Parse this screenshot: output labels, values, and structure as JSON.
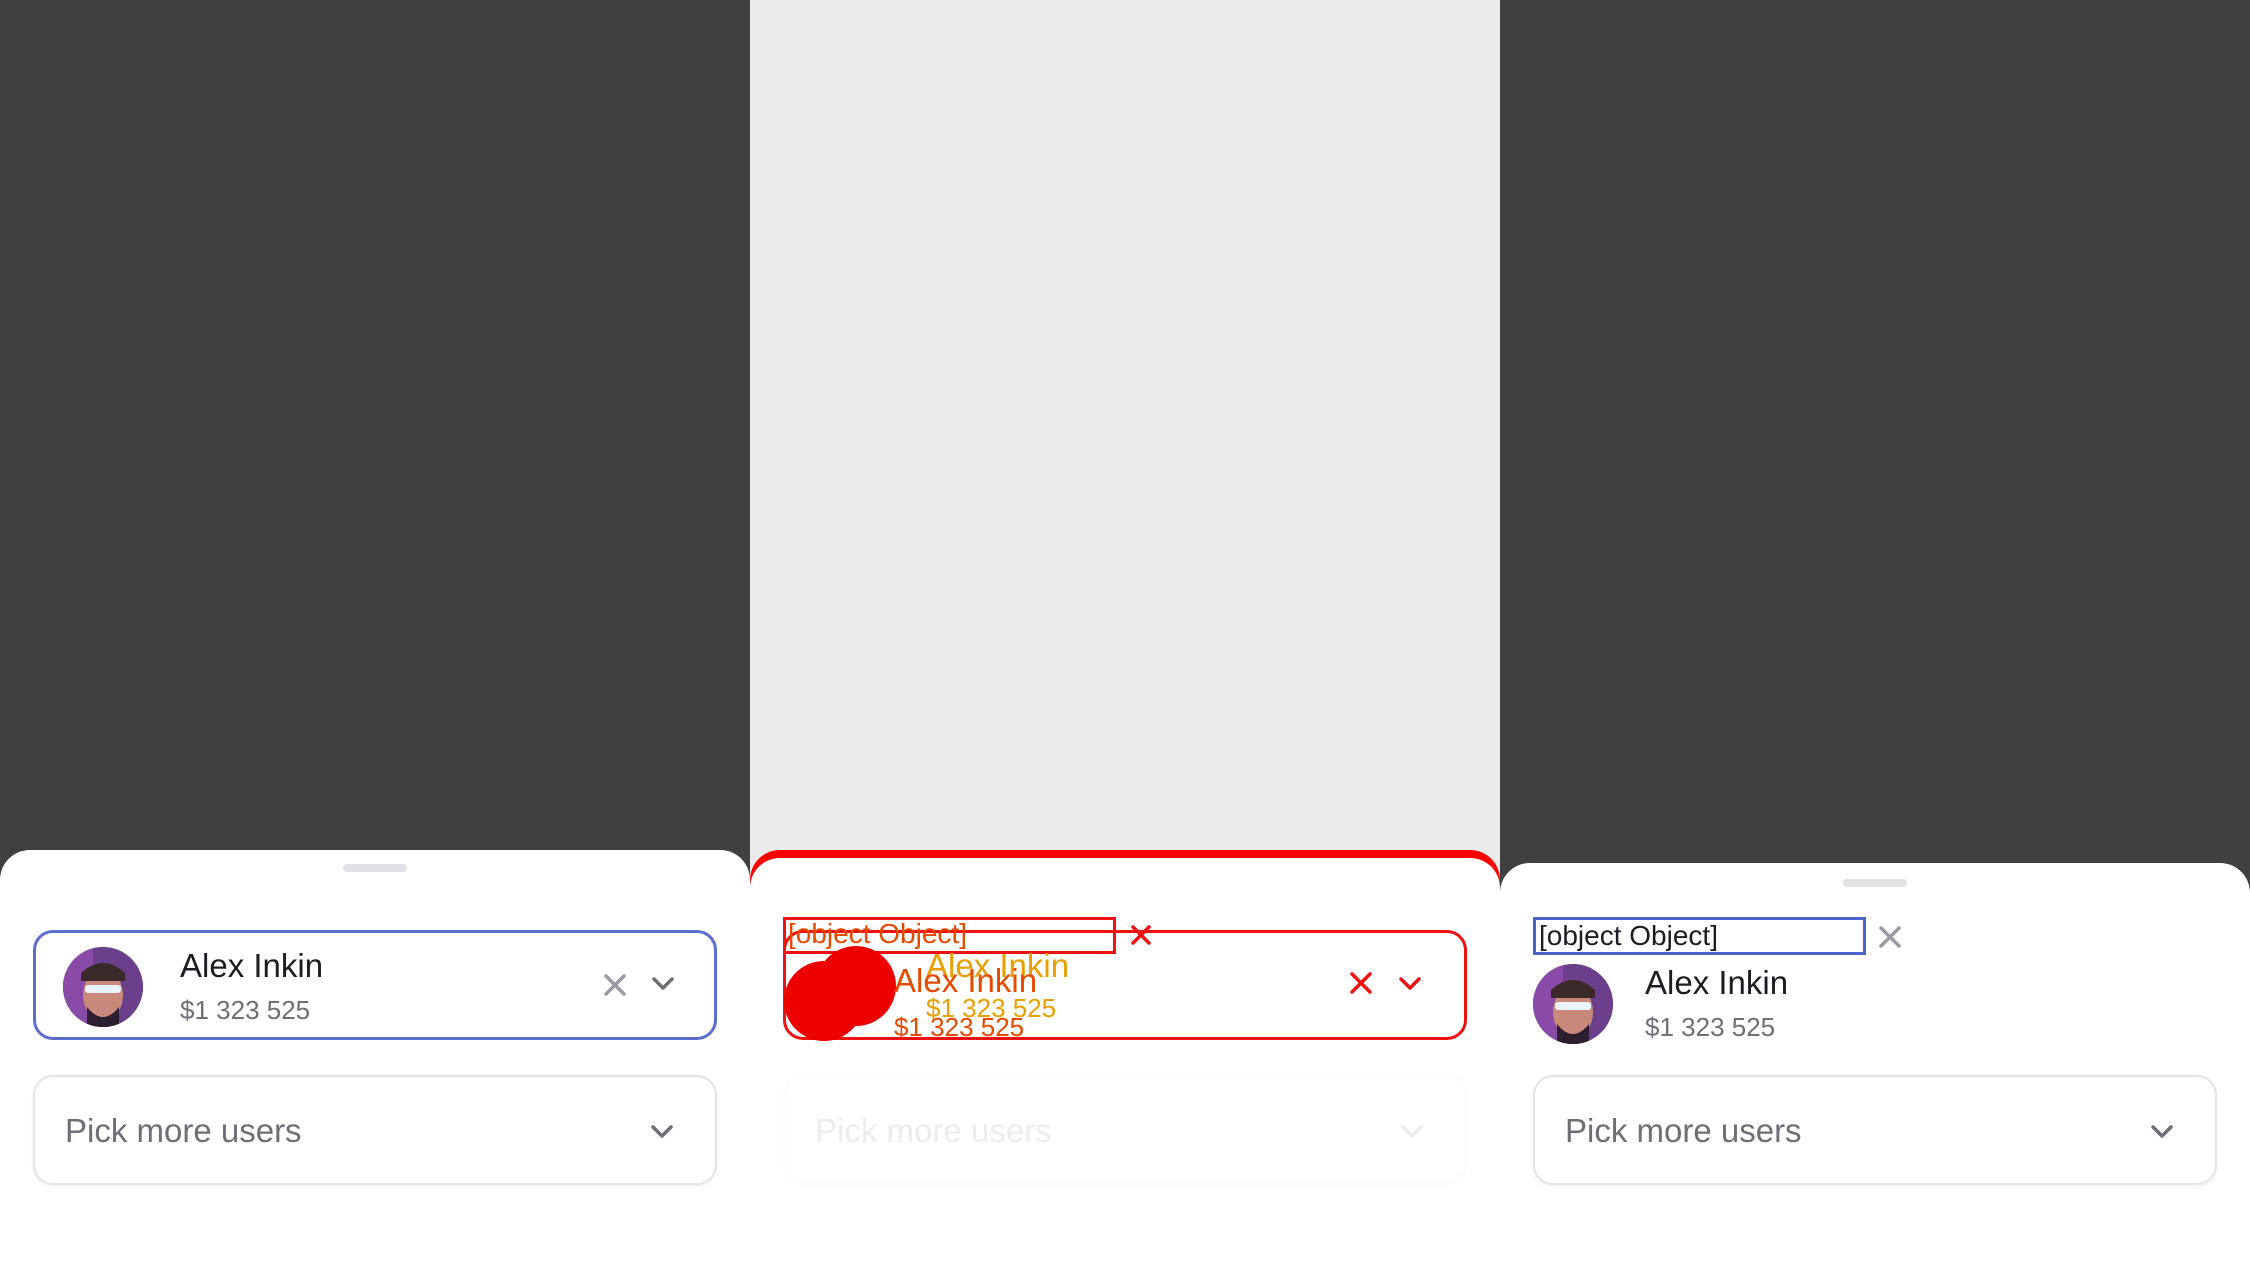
{
  "colors": {
    "backdrop_dark": "#404040",
    "backdrop_light": "#ebebeb",
    "accent_border": "#5a6fcc",
    "debug_red": "#ee1111"
  },
  "selected_user": {
    "name": "Alex Inkin",
    "amount": "$1 323 525"
  },
  "second_select": {
    "placeholder": "Pick more users"
  },
  "tag_label": "[object Object]",
  "icons": {
    "clear": "close-icon",
    "expand": "chevron-down-icon"
  }
}
